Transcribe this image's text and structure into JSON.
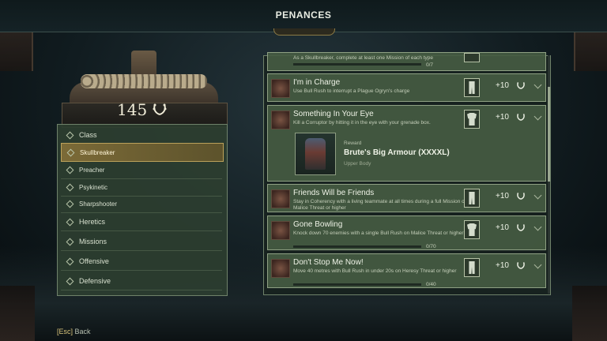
{
  "header": {
    "title": "PENANCES"
  },
  "points": {
    "total": "145",
    "icon": "laurel-icon"
  },
  "categories": [
    {
      "label": "Class",
      "level": "top"
    },
    {
      "label": "Skullbreaker",
      "level": "sub",
      "active": true
    },
    {
      "label": "Preacher",
      "level": "sub"
    },
    {
      "label": "Psykinetic",
      "level": "sub"
    },
    {
      "label": "Sharpshooter",
      "level": "sub"
    },
    {
      "label": "Heretics",
      "level": "top"
    },
    {
      "label": "Missions",
      "level": "top"
    },
    {
      "label": "Offensive",
      "level": "top"
    },
    {
      "label": "Defensive",
      "level": "top"
    }
  ],
  "penances": [
    {
      "name": "",
      "desc": "As a Skullbreaker, complete at least one Mission of each type",
      "progress": "0/7",
      "progress_fraction": 0
    },
    {
      "name": "I'm in Charge",
      "desc": "Use Bull Rush to interrupt a Plague Ogryn's charge",
      "points": "+10",
      "reward_icon": "legs-icon"
    },
    {
      "name": "Something In Your Eye",
      "desc": "Kill a Corruptor by hitting it in the eye with your grenade box.",
      "points": "+10",
      "reward_icon": "torso-icon",
      "reward": {
        "kicker": "Reward",
        "name": "Brute's Big Armour (XXXXL)",
        "type": "Upper Body"
      }
    },
    {
      "name": "Friends Will be Friends",
      "desc": "Stay in Coherency with a living teammate at all times during a full Mission on Malice Threat or higher",
      "points": "+10",
      "reward_icon": "legs-icon"
    },
    {
      "name": "Gone Bowling",
      "desc": "Knock down 70 enemies with a single Bull Rush on Malice Threat or higher",
      "points": "+10",
      "reward_icon": "torso-icon",
      "progress": "0/70",
      "progress_fraction": 0
    },
    {
      "name": "Don't Stop Me Now!",
      "desc": "Move 40 metres with Bull Rush in under 20s on Heresy Threat or higher",
      "points": "+10",
      "reward_icon": "legs-icon",
      "progress": "0/40",
      "progress_fraction": 0
    }
  ],
  "footer": {
    "key": "[Esc]",
    "label": "Back"
  }
}
